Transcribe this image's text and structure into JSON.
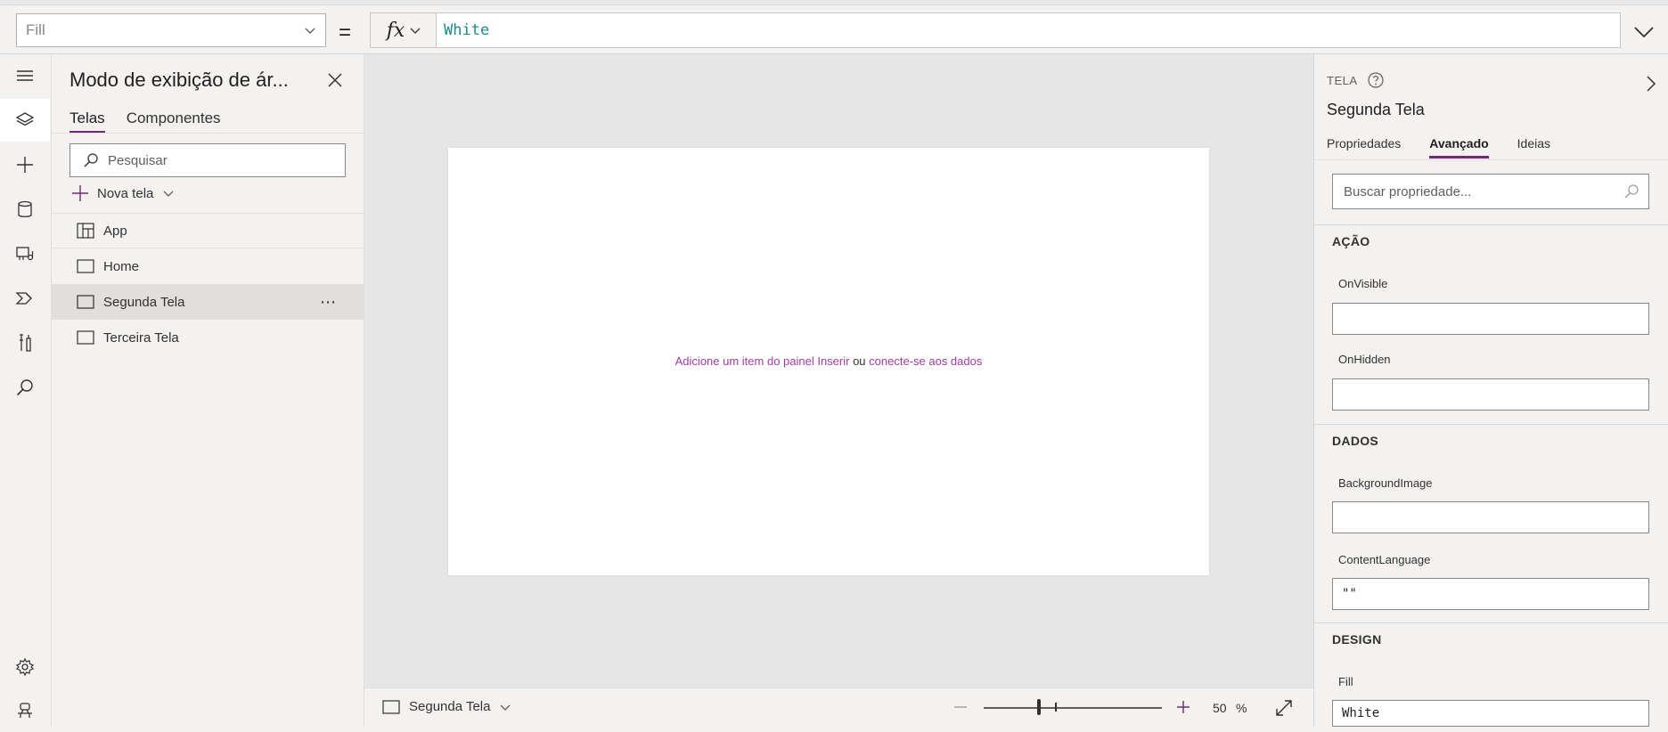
{
  "formula": {
    "property": "Fill",
    "equals": "=",
    "fx": "fx",
    "value": "White"
  },
  "tree": {
    "title": "Modo de exibição de ár...",
    "tabs": [
      "Telas",
      "Componentes"
    ],
    "search_placeholder": "Pesquisar",
    "new_screen": "Nova tela",
    "items": [
      {
        "label": "App"
      },
      {
        "label": "Home"
      },
      {
        "label": "Segunda Tela"
      },
      {
        "label": "Terceira Tela"
      }
    ],
    "more": "⋯"
  },
  "canvas": {
    "hint_link1": "Adicione um item do painel Inserir",
    "hint_or": " ou ",
    "hint_link2": "conecte-se aos dados"
  },
  "bottom": {
    "screen_name": "Segunda Tela",
    "zoom_value": "50",
    "zoom_unit": "%",
    "zoom_level": 0.31
  },
  "props": {
    "type_label": "TELA",
    "name": "Segunda Tela",
    "tabs": [
      "Propriedades",
      "Avançado",
      "Ideias"
    ],
    "search_placeholder": "Buscar propriedade...",
    "sections": {
      "acao": "AÇÃO",
      "dados": "DADOS",
      "design": "DESIGN"
    },
    "fields": {
      "onvisible_label": "OnVisible",
      "onvisible_value": "",
      "onhidden_label": "OnHidden",
      "onhidden_value": "",
      "bgimage_label": "BackgroundImage",
      "bgimage_value": "",
      "contentlang_label": "ContentLanguage",
      "contentlang_value": "\"\"",
      "fill_label": "Fill",
      "fill_value": "White"
    }
  },
  "colors": {
    "accent": "#742774",
    "link": "#a33aa3",
    "formula_text": "#1b8a8a"
  }
}
